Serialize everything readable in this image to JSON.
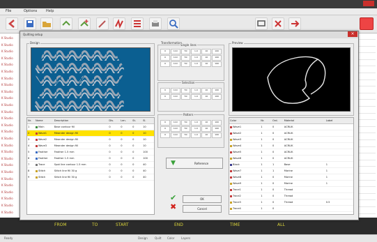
{
  "app": {
    "title": "",
    "menu": [
      "File",
      "Options",
      "Help"
    ]
  },
  "toolbar": {
    "icons": [
      "back-arrow-icon",
      "save-icon",
      "open-folder-icon",
      "layer-icon",
      "layer-add-icon",
      "pen-icon",
      "stitch-icon",
      "grid-icon",
      "print-icon",
      "zoom-icon",
      "measure-icon",
      "settings-icon",
      "export-icon"
    ]
  },
  "bg_list": [
    "K Studio",
    "K Studio",
    "K Studio",
    "K Studio",
    "K Studio",
    "K Studio",
    "K Studio",
    "K Studio",
    "K Studio",
    "K Studio",
    "K Studio",
    "K Studio",
    "K Studio",
    "K Studio",
    "K Studio",
    "K Studio",
    "K Studio",
    "K Studio",
    "K Studio",
    "K Studio",
    "K Studio",
    "K Studio",
    "K Studio",
    "K Studio",
    "K Studio",
    "K Studio",
    "K Studio"
  ],
  "dialog": {
    "title": "Quilting setup",
    "design_label": "Design",
    "transform_label": "Transformation",
    "preview_label": "Preview",
    "group1_label": "Single lines",
    "group2_label": "Selection",
    "group3_label": "Pattern",
    "group1_values": [
      "0",
      "110",
      "50",
      "1.0",
      "10",
      "100",
      "0",
      "110",
      "50",
      "1.0",
      "10",
      "100",
      "0",
      "110",
      "50",
      "1.0",
      "10",
      "100"
    ],
    "group2_values": [
      "0",
      "110",
      "50",
      "1.0",
      "10",
      "100",
      "0",
      "110",
      "50",
      "1.0",
      "10",
      "100"
    ],
    "group3_values": [
      "0",
      "110",
      "50",
      "1.0",
      "10",
      "100",
      "0",
      "110",
      "50",
      "1.0",
      "10",
      "100",
      "0",
      "110",
      "50",
      "1.0",
      "10",
      "100"
    ],
    "reference_button": "Reference",
    "ok_button": "OK",
    "cancel_button": "Cancel"
  },
  "layers_table": {
    "headers": [
      "Nr.",
      "Name",
      "Description",
      "Dis.",
      "Len.",
      "St.",
      "Sl."
    ],
    "rows": [
      {
        "nr": "1",
        "name": "Main",
        "desc": "Base contour fill",
        "c1": "0",
        "c2": "0",
        "c3": "0",
        "c4": "10",
        "color": "#3a8c3a",
        "sel": false
      },
      {
        "nr": "2",
        "name": "Wave1",
        "desc": "Meander design fill",
        "c1": "0",
        "c2": "0",
        "c3": "0",
        "c4": "10",
        "color": "#c23b3b",
        "sel": true
      },
      {
        "nr": "3",
        "name": "Wave2",
        "desc": "Meander design fill",
        "c1": "0",
        "c2": "0",
        "c3": "0",
        "c4": "10",
        "color": "#c23b3b",
        "sel": false
      },
      {
        "nr": "4",
        "name": "Wave3",
        "desc": "Meander design fill",
        "c1": "0",
        "c2": "0",
        "c3": "0",
        "c4": "10",
        "color": "#c23b3b",
        "sel": false
      },
      {
        "nr": "5",
        "name": "Feather",
        "desc": "Feather 1.5 mm",
        "c1": "0",
        "c2": "0",
        "c3": "0",
        "c4": "100",
        "color": "#3a6cc2",
        "sel": false
      },
      {
        "nr": "6",
        "name": "Feather",
        "desc": "Feather 1.5 mm",
        "c1": "0",
        "c2": "0",
        "c3": "0",
        "c4": "100",
        "color": "#3a6cc2",
        "sel": false
      },
      {
        "nr": "7",
        "name": "Trace",
        "desc": "Spot line contour 1.5 mm",
        "c1": "0",
        "c2": "0",
        "c3": "0",
        "c4": "40",
        "color": "#777777",
        "sel": false
      },
      {
        "nr": "8",
        "name": "Stitch",
        "desc": "Stitch line fill 30 g",
        "c1": "0",
        "c2": "0",
        "c3": "0",
        "c4": "40",
        "color": "#c9a227",
        "sel": false
      },
      {
        "nr": "9",
        "name": "Stitch",
        "desc": "Stitch line fill 30 g",
        "c1": "0",
        "c2": "0",
        "c3": "0",
        "c4": "40",
        "color": "#c9a227",
        "sel": false
      }
    ]
  },
  "colors_table": {
    "headers": [
      "Color",
      "Nr.",
      "Ord.",
      "Material",
      "Label"
    ],
    "rows": [
      {
        "name": "Wave1",
        "color": "#c23b3b",
        "a": "1",
        "b": "0",
        "mat": "ACRLIK",
        "label": ""
      },
      {
        "name": "Wave2",
        "color": "#c23b3b",
        "a": "1",
        "b": "0",
        "mat": "ACRLIK",
        "label": ""
      },
      {
        "name": "Wave3",
        "color": "#c9a227",
        "a": "1",
        "b": "0",
        "mat": "ACRLIK",
        "label": ""
      },
      {
        "name": "Wave4",
        "color": "#c9a227",
        "a": "1",
        "b": "0",
        "mat": "ACRLIK",
        "label": ""
      },
      {
        "name": "Wave5",
        "color": "#c23b3b",
        "a": "1",
        "b": "0",
        "mat": "ACRLIK",
        "label": ""
      },
      {
        "name": "Wave6",
        "color": "#c9a227",
        "a": "1",
        "b": "0",
        "mat": "ACRLIK",
        "label": ""
      },
      {
        "name": "Black",
        "color": "#3a3a8c",
        "a": "1",
        "b": "1",
        "mat": "Base",
        "label": "1"
      },
      {
        "name": "Wave7",
        "color": "#c23b3b",
        "a": "1",
        "b": "1",
        "mat": "Marine",
        "label": "1"
      },
      {
        "name": "Wave8",
        "color": "#c23b3b",
        "a": "1",
        "b": "0",
        "mat": "Marine",
        "label": "1"
      },
      {
        "name": "Wave9",
        "color": "#c9a227",
        "a": "1",
        "b": "0",
        "mat": "Marine",
        "label": "1"
      },
      {
        "name": "Trace1",
        "color": "#c23b3b",
        "a": "1",
        "b": "0",
        "mat": "Thread",
        "label": ""
      },
      {
        "name": "Trace2",
        "color": "#c23b3b",
        "a": "1",
        "b": "0",
        "mat": "Thread",
        "label": ""
      },
      {
        "name": "Trace3",
        "color": "#c9a227",
        "a": "1",
        "b": "0",
        "mat": "Thread",
        "label": "0.5"
      },
      {
        "name": "Trace4",
        "color": "#c9a227",
        "a": "1",
        "b": "0",
        "mat": "",
        "label": ""
      }
    ]
  },
  "right_toolbar": {
    "icons": [
      "monitor-icon",
      "cut-icon",
      "transfer-icon"
    ]
  },
  "bottom_strip": [
    "FROM",
    "TO",
    "START",
    "END",
    "TIME",
    "ALL"
  ],
  "status": {
    "left": "Ready",
    "items": [
      "Design",
      "Quilt",
      "Color",
      "Layers"
    ]
  }
}
